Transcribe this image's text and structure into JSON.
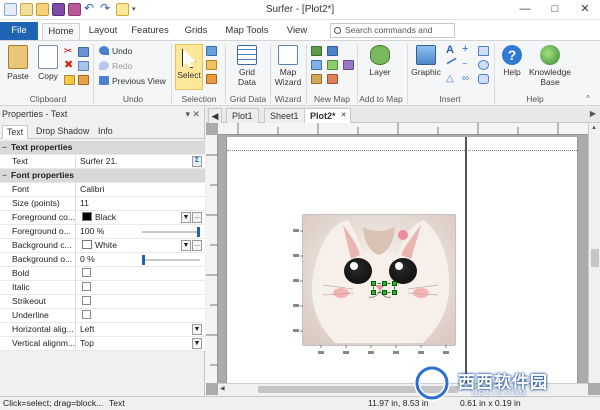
{
  "window": {
    "title": "Surfer - [Plot2*]",
    "controls": {
      "minimize": "—",
      "maximize": "□",
      "close": "✕"
    }
  },
  "quick_access": [
    "new-icon",
    "new-plot-icon",
    "open-icon",
    "save-icon",
    "save-all-icon",
    "undo-icon",
    "redo-icon",
    "select-icon",
    "dropdown-icon"
  ],
  "ribbon_tabs": [
    "File",
    "Home",
    "Layout",
    "Features",
    "Grids",
    "Map Tools",
    "View"
  ],
  "active_tab": "Home",
  "search": {
    "placeholder": "Search commands and Hel..."
  },
  "ribbon": {
    "clipboard": {
      "paste": "Paste",
      "copy": "Copy",
      "label": "Clipboard"
    },
    "undo": {
      "undo": "Undo",
      "redo": "Redo",
      "previous_view": "Previous View",
      "label": "Undo"
    },
    "selection": {
      "select": "Select",
      "label": "Selection"
    },
    "grid_data": {
      "button": "Grid Data",
      "label": "Grid Data"
    },
    "wizard": {
      "button": "Map Wizard",
      "label": "Wizard"
    },
    "new_map": {
      "label": "New Map"
    },
    "add_to_map": {
      "layer": "Layer",
      "label": "Add to Map"
    },
    "insert": {
      "graphic": "Graphic",
      "label": "Insert"
    },
    "help": {
      "help": "Help",
      "knowledge_base": "Knowledge Base",
      "label": "Help"
    }
  },
  "properties": {
    "title": "Properties - Text",
    "header_controls": "▾ ✕",
    "tabs": [
      "Text",
      "Drop Shadow",
      "Info"
    ],
    "active_tab": "Text",
    "rows": [
      {
        "type": "section",
        "label": "Text properties"
      },
      {
        "type": "text-edit",
        "label": "Text",
        "value": "Surfer 21."
      },
      {
        "type": "section",
        "label": "Font properties"
      },
      {
        "type": "value",
        "label": "Font",
        "value": "Calibri"
      },
      {
        "type": "value",
        "label": "Size (points)",
        "value": "11"
      },
      {
        "type": "color",
        "label": "Foreground co...",
        "value": "Black",
        "color": "#000000"
      },
      {
        "type": "slider",
        "label": "Foreground o...",
        "value": "100 %",
        "level": 1.0
      },
      {
        "type": "color",
        "label": "Background c...",
        "value": "White",
        "color": "#ffffff"
      },
      {
        "type": "slider",
        "label": "Background o...",
        "value": "0 %",
        "level": 0.0
      },
      {
        "type": "check",
        "label": "Bold",
        "value": ""
      },
      {
        "type": "check",
        "label": "Italic",
        "value": ""
      },
      {
        "type": "check",
        "label": "Strikeout",
        "value": ""
      },
      {
        "type": "check",
        "label": "Underline",
        "value": ""
      },
      {
        "type": "dropdown",
        "label": "Horizontal alig...",
        "value": "Left"
      },
      {
        "type": "dropdown",
        "label": "Vertical alignm...",
        "value": "Top"
      }
    ]
  },
  "documents": {
    "tabs": [
      "Plot1",
      "Sheet1",
      "Plot2*"
    ],
    "active": "Plot2*",
    "close_glyph": "✕"
  },
  "status": {
    "hint": "Click=select; drag=block...",
    "object": "Text",
    "position": "11.97 in, 8.53 in",
    "size": "0.61 in x 0.19 in"
  },
  "watermark": {
    "text": "西西软件园",
    "sub": "CR173.COM"
  },
  "colors": {
    "file_tab": "#1e63b4",
    "selection_highlight": "#fde79b"
  }
}
